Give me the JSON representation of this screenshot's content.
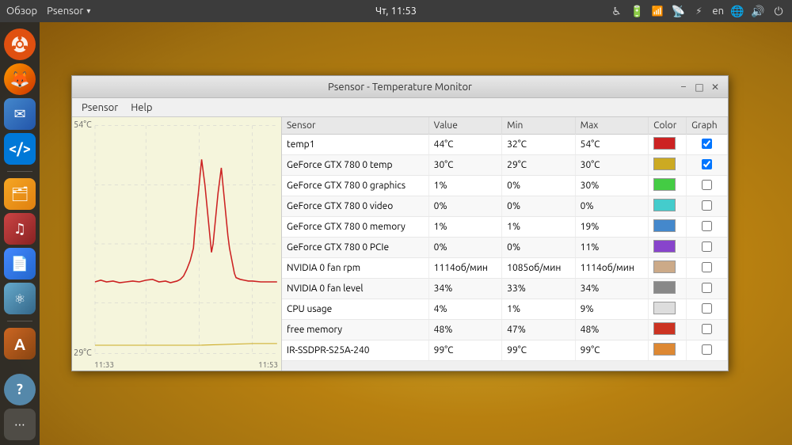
{
  "desktop": {
    "bg_color": "#b88010"
  },
  "top_panel": {
    "overview_label": "Обзор",
    "app_menu_label": "Psensor",
    "datetime": "Чт, 11:53",
    "lang": "en"
  },
  "dock": {
    "icons": [
      {
        "name": "ubuntu-icon",
        "label": "Ubuntu",
        "class": "ubuntu",
        "glyph": ""
      },
      {
        "name": "firefox-icon",
        "label": "Firefox",
        "class": "firefox",
        "glyph": "🦊"
      },
      {
        "name": "mail-icon",
        "label": "Mail",
        "class": "mail",
        "glyph": "✉"
      },
      {
        "name": "vscode-icon",
        "label": "VS Code",
        "class": "vscode",
        "glyph": "⌨"
      },
      {
        "name": "files-icon",
        "label": "Files",
        "class": "files",
        "glyph": "🗂"
      },
      {
        "name": "rhythmbox-icon",
        "label": "Rhythmbox",
        "class": "rhythmbox",
        "glyph": "♪"
      },
      {
        "name": "docs-icon",
        "label": "Docs",
        "class": "docs",
        "glyph": "📄"
      },
      {
        "name": "atom-icon",
        "label": "Atom",
        "class": "atom",
        "glyph": "⚛"
      },
      {
        "name": "installer-icon",
        "label": "Installer",
        "class": "installer",
        "glyph": "A"
      },
      {
        "name": "help-icon",
        "label": "Help",
        "class": "help",
        "glyph": "?"
      },
      {
        "name": "apps-icon",
        "label": "Apps",
        "class": "apps",
        "glyph": "⋯"
      }
    ]
  },
  "window": {
    "title": "Psensor - Temperature Monitor",
    "minimize_label": "–",
    "maximize_label": "□",
    "close_label": "✕",
    "menu": {
      "items": [
        "Psensor",
        "Help"
      ]
    }
  },
  "graph": {
    "y_top": "54°C",
    "y_bottom": "29°C",
    "x_left": "11:33",
    "x_right": "11:53"
  },
  "table": {
    "columns": [
      "Sensor",
      "Value",
      "Min",
      "Max",
      "Color",
      "Graph"
    ],
    "rows": [
      {
        "sensor": "temp1",
        "value": "44°C",
        "min": "32°C",
        "max": "54°C",
        "color": "#cc2222",
        "graph": true
      },
      {
        "sensor": "GeForce GTX 780 0 temp",
        "value": "30°C",
        "min": "29°C",
        "max": "30°C",
        "color": "#ccaa22",
        "graph": true
      },
      {
        "sensor": "GeForce GTX 780 0 graphics",
        "value": "1%",
        "min": "0%",
        "max": "30%",
        "color": "#44cc44",
        "graph": false
      },
      {
        "sensor": "GeForce GTX 780 0 video",
        "value": "0%",
        "min": "0%",
        "max": "0%",
        "color": "#44cccc",
        "graph": false
      },
      {
        "sensor": "GeForce GTX 780 0 memory",
        "value": "1%",
        "min": "1%",
        "max": "19%",
        "color": "#4488cc",
        "graph": false
      },
      {
        "sensor": "GeForce GTX 780 0 PCIe",
        "value": "0%",
        "min": "0%",
        "max": "11%",
        "color": "#8844cc",
        "graph": false
      },
      {
        "sensor": "NVIDIA 0 fan rpm",
        "value": "1114об/мин",
        "min": "1085об/мин",
        "max": "1114об/мин",
        "color": "#ccaa88",
        "graph": false
      },
      {
        "sensor": "NVIDIA 0 fan level",
        "value": "34%",
        "min": "33%",
        "max": "34%",
        "color": "#888888",
        "graph": false
      },
      {
        "sensor": "CPU usage",
        "value": "4%",
        "min": "1%",
        "max": "9%",
        "color": "#dddddd",
        "graph": false
      },
      {
        "sensor": "free memory",
        "value": "48%",
        "min": "47%",
        "max": "48%",
        "color": "#cc3322",
        "graph": false
      },
      {
        "sensor": "IR-SSDPR-S25A-240",
        "value": "99°C",
        "min": "99°C",
        "max": "99°C",
        "color": "#dd8833",
        "graph": false
      }
    ]
  }
}
